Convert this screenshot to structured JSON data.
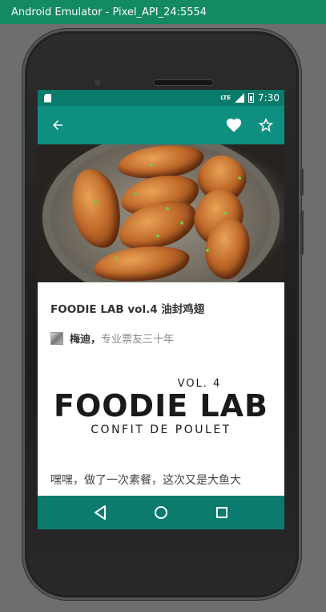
{
  "emulator": {
    "title": "Android Emulator - Pixel_API_24:5554"
  },
  "statusbar": {
    "lte": "LTE",
    "time": "7:30"
  },
  "appbar": {
    "back_icon": "arrow-back-icon",
    "favorite_icon": "heart-icon",
    "star_icon": "star-outline-icon"
  },
  "article": {
    "title": "FOODIE LAB vol.4 油封鸡翅",
    "author": {
      "name": "梅迪",
      "separator": "，",
      "bio": "专业票友三十年"
    },
    "logo": {
      "vol": "VOL. 4",
      "main": "FOODIE LAB",
      "sub": "CONFIT DE POULET"
    },
    "body_start": "嘿嘿，做了一次素餐，这次又是大鱼大"
  },
  "navbar": {
    "back_icon": "nav-back-icon",
    "home_icon": "nav-home-icon",
    "recents_icon": "nav-recents-icon"
  },
  "colors": {
    "primary": "#0e8f80",
    "primary_dark": "#0a7a6b",
    "titlebar": "#138a5f"
  }
}
